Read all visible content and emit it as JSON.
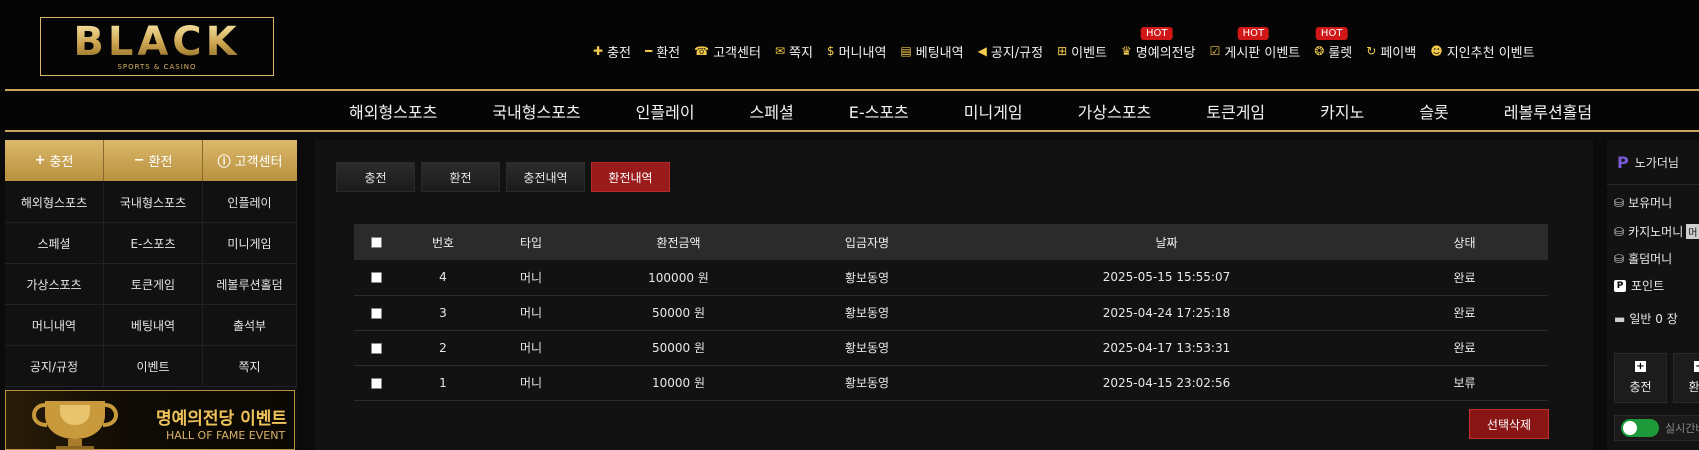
{
  "logo": {
    "text": "BLACK",
    "subtitle": "SPORTS & CASINO"
  },
  "top_nav": [
    {
      "label": "충전",
      "icon": "plus-icon",
      "hot": false
    },
    {
      "label": "환전",
      "icon": "minus-icon",
      "hot": false
    },
    {
      "label": "고객센터",
      "icon": "support-icon",
      "hot": false
    },
    {
      "label": "쪽지",
      "icon": "mail-icon",
      "hot": false
    },
    {
      "label": "머니내역",
      "icon": "money-bag-icon",
      "hot": false
    },
    {
      "label": "베팅내역",
      "icon": "ticket-icon",
      "hot": false
    },
    {
      "label": "공지/규정",
      "icon": "megaphone-icon",
      "hot": false
    },
    {
      "label": "이벤트",
      "icon": "gift-icon",
      "hot": false
    },
    {
      "label": "명예의전당",
      "icon": "trophy-icon",
      "hot": true
    },
    {
      "label": "게시판 이벤트",
      "icon": "checkbox-icon",
      "hot": true
    },
    {
      "label": "룰렛",
      "icon": "roulette-icon",
      "hot": true
    },
    {
      "label": "페이백",
      "icon": "refresh-icon",
      "hot": false
    },
    {
      "label": "지인추천 이벤트",
      "icon": "users-icon",
      "hot": false
    }
  ],
  "hot_badge": "HOT",
  "main_nav": [
    "해외형스포츠",
    "국내형스포츠",
    "인플레이",
    "스페셜",
    "E-스포츠",
    "미니게임",
    "가상스포츠",
    "토큰게임",
    "카지노",
    "슬롯",
    "레볼루션홀덤"
  ],
  "sidebar": {
    "top_buttons": [
      {
        "label": "충전",
        "icon": "plus-icon"
      },
      {
        "label": "환전",
        "icon": "minus-icon"
      },
      {
        "label": "고객센터",
        "icon": "info-icon"
      }
    ],
    "grid": [
      "해외형스포츠",
      "국내형스포츠",
      "인플레이",
      "스페셜",
      "E-스포츠",
      "미니게임",
      "가상스포츠",
      "토큰게임",
      "레볼루션홀덤",
      "머니내역",
      "베팅내역",
      "출석부",
      "공지/규정",
      "이벤트",
      "쪽지"
    ],
    "banner": {
      "title": "명예의전당 이벤트",
      "subtitle": "HALL OF FAME EVENT"
    }
  },
  "tabs": [
    {
      "label": "충전",
      "active": false
    },
    {
      "label": "환전",
      "active": false
    },
    {
      "label": "충전내역",
      "active": false
    },
    {
      "label": "환전내역",
      "active": true
    }
  ],
  "table": {
    "columns": [
      "번호",
      "타입",
      "환전금액",
      "입금자명",
      "날짜",
      "상태"
    ],
    "rows": [
      {
        "no": "4",
        "type": "머니",
        "amount": "100000 원",
        "name": "황보동영",
        "date": "2025-05-15 15:55:07",
        "status": "완료"
      },
      {
        "no": "3",
        "type": "머니",
        "amount": "50000 원",
        "name": "황보동영",
        "date": "2025-04-24 17:25:18",
        "status": "완료"
      },
      {
        "no": "2",
        "type": "머니",
        "amount": "50000 원",
        "name": "황보동영",
        "date": "2025-04-17 13:53:31",
        "status": "완료"
      },
      {
        "no": "1",
        "type": "머니",
        "amount": "10000 원",
        "name": "황보동영",
        "date": "2025-04-15 23:02:56",
        "status": "보류"
      }
    ],
    "delete_label": "선택삭제"
  },
  "right_panel": {
    "username": "노가더님",
    "balance_label": "보유머니",
    "casino_label": "카지노머니",
    "casino_chip": "머",
    "holdem_label": "홀덤머니",
    "point_label": "포인트",
    "coupon_label": "일반 0 장",
    "deposit_label": "충전",
    "withdraw_label": "환전",
    "toggle_label": "실시간배"
  },
  "colors": {
    "gold": "#c9a45a",
    "active_tab": "#9a1b1b",
    "hot": "#d01818",
    "background": "#0b0b0b"
  }
}
